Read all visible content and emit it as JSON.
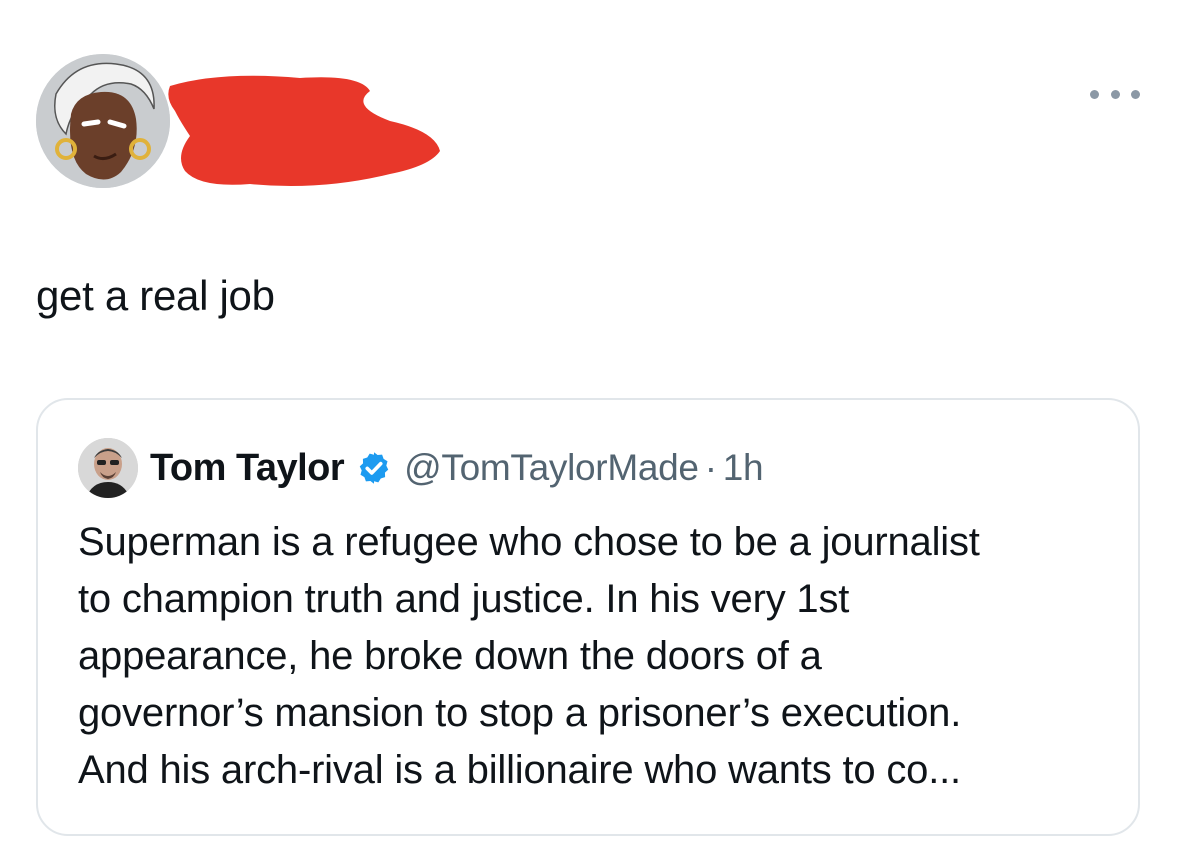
{
  "tweet": {
    "author": {
      "avatar_icon": "avatar-image",
      "name_redacted": true,
      "redaction_color": "#e8372a"
    },
    "more_icon": "ellipsis-icon",
    "text": "get a real job"
  },
  "quoted_tweet": {
    "avatar_icon": "avatar-image",
    "name": "Tom Taylor",
    "verified_icon": "verified-badge-icon",
    "verified_color": "#1d9bf0",
    "handle": "@TomTaylorMade",
    "separator": "·",
    "time": "1h",
    "body_lines": [
      "Superman is a refugee who chose to be a journalist",
      "to champion truth and justice. In his very 1st",
      "appearance, he broke down the doors of a",
      "governor’s mansion to stop a prisoner’s execution.",
      "And his arch-rival is a billionaire who wants to co..."
    ]
  }
}
